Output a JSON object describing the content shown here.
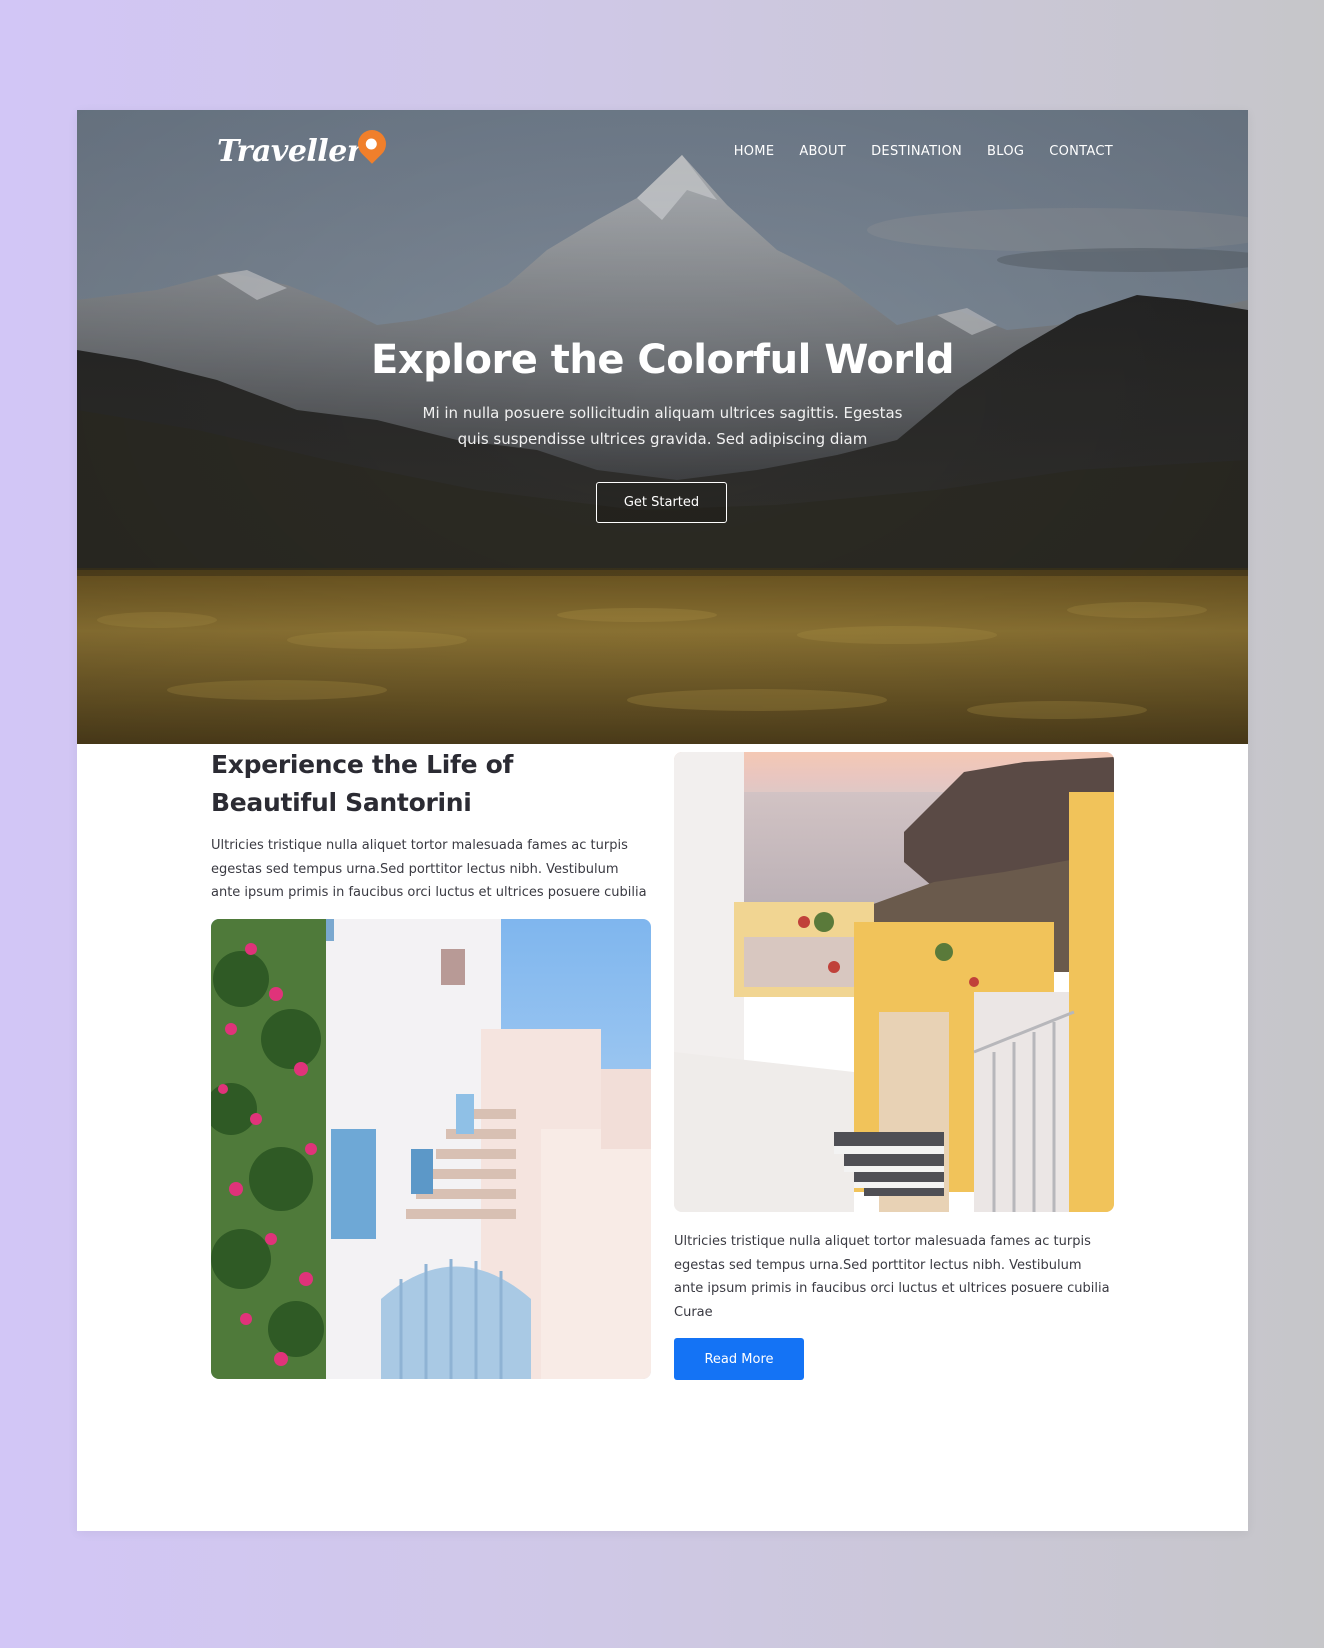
{
  "brand": {
    "logo_text": "Traveller"
  },
  "nav": {
    "items": [
      "HOME",
      "ABOUT",
      "DESTINATION",
      "BLOG",
      "CONTACT"
    ]
  },
  "hero": {
    "title": "Explore the Colorful World",
    "subtitle": "Mi in nulla posuere sollicitudin aliquam ultrices sagittis. Egestas quis suspendisse ultrices gravida. Sed adipiscing diam",
    "cta_label": "Get Started"
  },
  "section": {
    "heading": "Experience the Life of Beautiful Santorini",
    "intro": "Ultricies tristique nulla aliquet tortor malesuada fames ac turpis egestas sed tempus urna.Sed porttitor lectus nibh. Vestibulum ante ipsum primis in faucibus orci luctus et ultrices posuere cubilia",
    "body": "Ultricies tristique nulla aliquet tortor malesuada fames ac turpis egestas sed tempus urna.Sed porttitor lectus nibh. Vestibulum ante ipsum primis in faucibus orci luctus et ultrices posuere cubilia Curae",
    "read_more_label": "Read More"
  },
  "colors": {
    "accent_blue": "#1473f5",
    "logo_pin": "#f07f2b",
    "heading_text": "#2b2b33"
  }
}
